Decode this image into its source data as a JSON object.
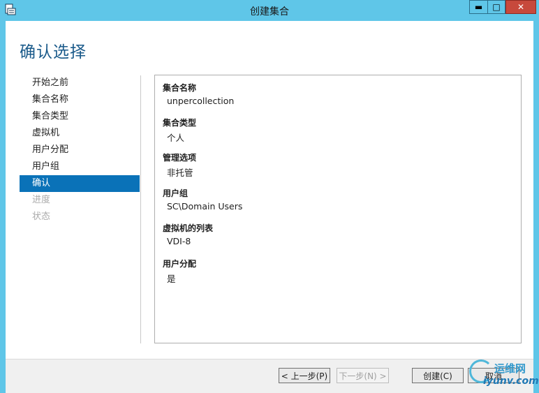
{
  "window": {
    "title": "创建集合",
    "controls": {
      "minimize": "▬",
      "maximize": "□",
      "close": "✕"
    }
  },
  "page_title": "确认选择",
  "nav": {
    "items": [
      {
        "label": "开始之前",
        "state": "normal"
      },
      {
        "label": "集合名称",
        "state": "normal"
      },
      {
        "label": "集合类型",
        "state": "normal"
      },
      {
        "label": "虚拟机",
        "state": "normal"
      },
      {
        "label": "用户分配",
        "state": "normal"
      },
      {
        "label": "用户组",
        "state": "normal"
      },
      {
        "label": "确认",
        "state": "active"
      },
      {
        "label": "进度",
        "state": "disabled"
      },
      {
        "label": "状态",
        "state": "disabled"
      }
    ]
  },
  "summary": [
    {
      "label": "集合名称",
      "value": "unpercollection"
    },
    {
      "label": "集合类型",
      "value": "个人"
    },
    {
      "label": "管理选项",
      "value": "非托管"
    },
    {
      "label": "用户组",
      "value": "SC\\Domain Users"
    },
    {
      "label": "虚拟机的列表",
      "value": "VDI-8"
    },
    {
      "label": "用户分配",
      "value": "是"
    }
  ],
  "footer": {
    "prev_label": "< 上一步(P)",
    "next_label": "下一步(N) >",
    "create_label": "创建(C)",
    "cancel_label": "取消"
  },
  "watermark": {
    "cn": "运维网",
    "en": "iyunv.com"
  },
  "colors": {
    "titlebar": "#5fc6e8",
    "accent": "#0a72b8",
    "title_text": "#1a5a8a",
    "close": "#c7493c"
  },
  "icons": [
    "app-icon",
    "minimize-icon",
    "maximize-icon",
    "close-icon",
    "watermark-logo-icon"
  ]
}
